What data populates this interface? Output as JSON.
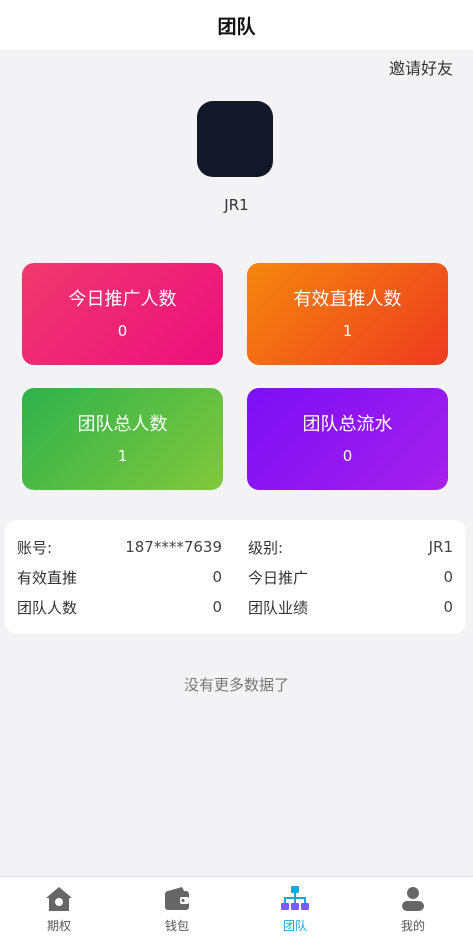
{
  "header": {
    "title": "团队"
  },
  "invite_label": "邀请好友",
  "profile": {
    "username": "JR1"
  },
  "cards": [
    {
      "label": "今日推广人数",
      "value": "0"
    },
    {
      "label": "有效直推人数",
      "value": "1"
    },
    {
      "label": "团队总人数",
      "value": "1"
    },
    {
      "label": "团队总流水",
      "value": "0"
    }
  ],
  "info": {
    "account_label": "账号:",
    "account_value": "187****7639",
    "level_label": "级别:",
    "level_value": "JR1",
    "direct_label": "有效直推",
    "direct_value": "0",
    "today_label": "今日推广",
    "today_value": "0",
    "team_count_label": "团队人数",
    "team_count_value": "0",
    "team_perf_label": "团队业绩",
    "team_perf_value": "0"
  },
  "no_more": "没有更多数据了",
  "tabbar": {
    "items": [
      {
        "label": "期权",
        "icon": "home-icon",
        "active": false
      },
      {
        "label": "钱包",
        "icon": "wallet-icon",
        "active": false
      },
      {
        "label": "团队",
        "icon": "team-icon",
        "active": true
      },
      {
        "label": "我的",
        "icon": "user-icon",
        "active": false
      }
    ],
    "active_color": "#1aa7d8",
    "inactive_color": "#555555"
  }
}
